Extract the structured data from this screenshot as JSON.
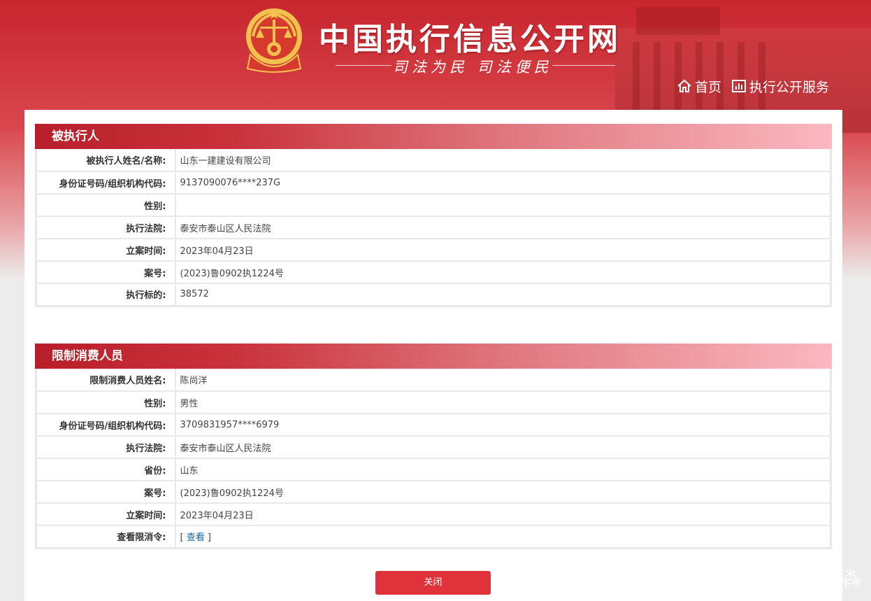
{
  "header": {
    "site_title": "中国执行信息公开网",
    "slogan": "司法为民  司法便民",
    "nav_home": "首页",
    "nav_service": "执行公开服务"
  },
  "debtor": {
    "title": "被执行人",
    "rows": [
      {
        "label": "被执行人姓名/名称:",
        "value": "山东一建建设有限公司"
      },
      {
        "label": "身份证号码/组织机构代码:",
        "value": "9137090076****237G"
      },
      {
        "label": "性别:",
        "value": ""
      },
      {
        "label": "执行法院:",
        "value": "泰安市泰山区人民法院"
      },
      {
        "label": "立案时间:",
        "value": "2023年04月23日"
      },
      {
        "label": "案号:",
        "value": "(2023)鲁0902执1224号"
      },
      {
        "label": "执行标的:",
        "value": "38572"
      }
    ]
  },
  "restricted": {
    "title": "限制消费人员",
    "rows": [
      {
        "label": "限制消费人员姓名:",
        "value": "陈尚洋"
      },
      {
        "label": "性别:",
        "value": "男性"
      },
      {
        "label": "身份证号码/组织机构代码:",
        "value": "3709831957****6979"
      },
      {
        "label": "执行法院:",
        "value": "泰安市泰山区人民法院"
      },
      {
        "label": "省份:",
        "value": "山东"
      },
      {
        "label": "案号:",
        "value": "(2023)鲁0902执1224号"
      },
      {
        "label": "立案时间:",
        "value": "2023年04月23日"
      },
      {
        "label": "查看限消令:",
        "bracket_open": "[ ",
        "link": "查看",
        "bracket_close": " ]"
      }
    ]
  },
  "close_label": "关闭",
  "colors": {
    "primary_red": "#c8262d",
    "button_red": "#e0323a",
    "link_blue": "#1a5fa8"
  },
  "icons": {
    "emblem": "national-court-emblem",
    "home": "home-icon",
    "service": "bar-chart-icon"
  }
}
